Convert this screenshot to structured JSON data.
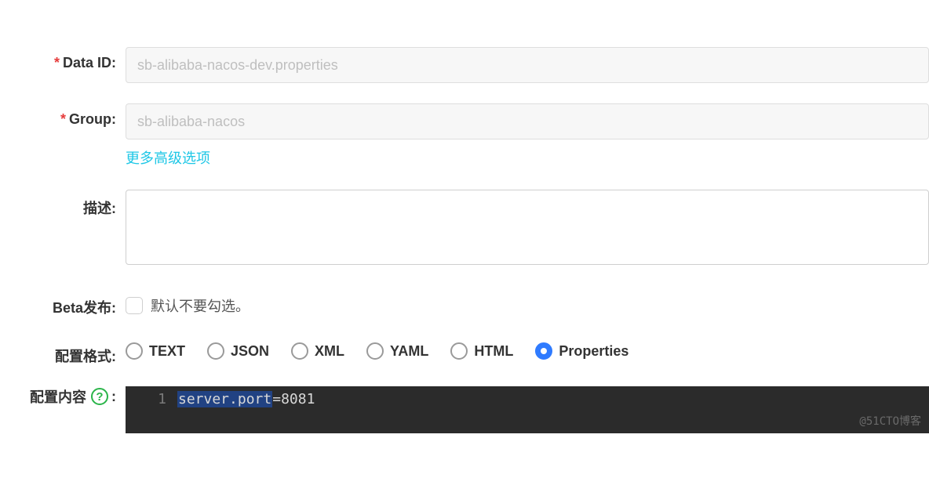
{
  "labels": {
    "data_id": "Data ID:",
    "group": "Group:",
    "description": "描述:",
    "beta": "Beta发布:",
    "format": "配置格式:",
    "content": "配置内容",
    "content_colon": ":"
  },
  "fields": {
    "data_id_value": "sb-alibaba-nacos-dev.properties",
    "group_value": "sb-alibaba-nacos",
    "description_value": "",
    "beta_checked": false,
    "beta_hint": "默认不要勾选。"
  },
  "advanced_link": "更多高级选项",
  "formats": {
    "options": [
      "TEXT",
      "JSON",
      "XML",
      "YAML",
      "HTML",
      "Properties"
    ],
    "selected": "Properties"
  },
  "editor": {
    "line_number": "1",
    "code_key": "server.port",
    "code_eq": "=",
    "code_val": "8081"
  },
  "watermark": "@51CTO博客"
}
